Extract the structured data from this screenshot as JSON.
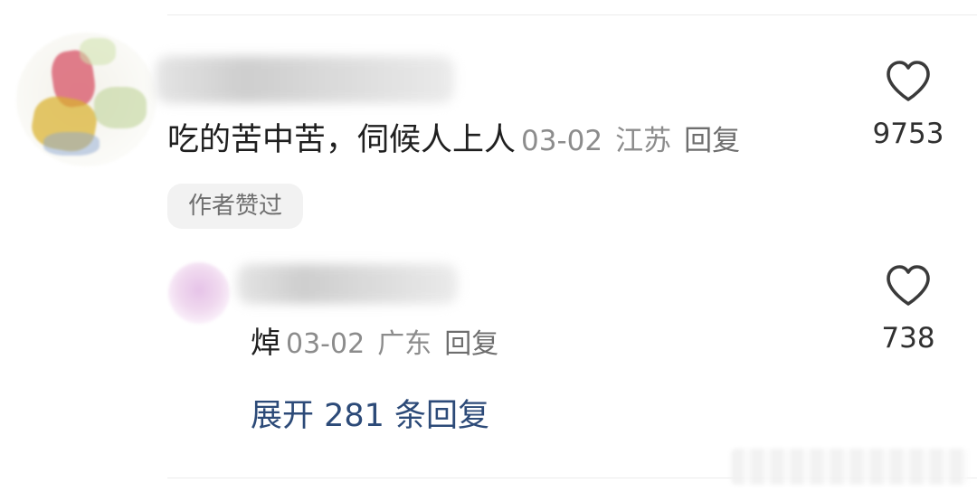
{
  "comment": {
    "text": "吃的苦中苦，伺候人上人",
    "date": "03-02",
    "location": "江苏",
    "reply_label": "回复",
    "likes": "9753",
    "author_badge": "作者赞过",
    "avatar_icon": "user-avatar-blurred",
    "username_icon": "blurred-username"
  },
  "reply": {
    "text": "焯",
    "date": "03-02",
    "location": "广东",
    "reply_label": "回复",
    "likes": "738",
    "avatar_icon": "user-avatar-blurred",
    "username_icon": "blurred-username"
  },
  "expand_label": "展开 281 条回复",
  "icons": {
    "like": "heart-outline-icon"
  },
  "colors": {
    "link": "#2c4a78",
    "meta": "#8c8c8c",
    "badge_bg": "#f2f2f2"
  }
}
